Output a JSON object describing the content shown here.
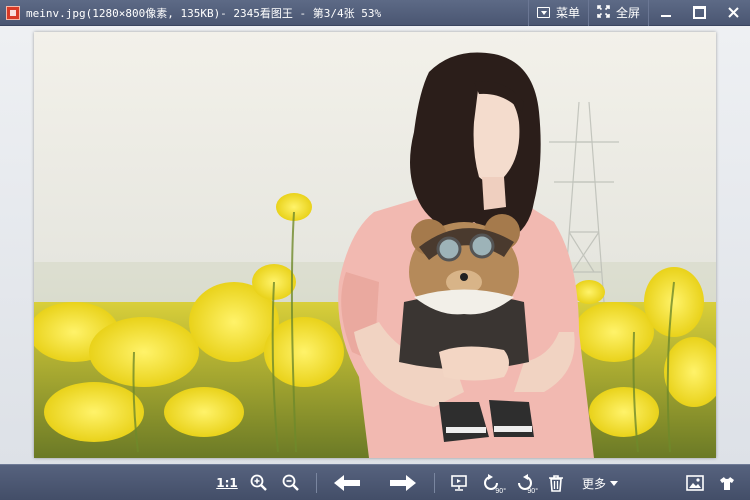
{
  "window": {
    "title": "meinv.jpg(1280×800像素, 135KB)- 2345看图王 - 第3/4张 53%",
    "menu_label": "菜单",
    "fullscreen_label": "全屏"
  },
  "toolbar": {
    "ratio_label": "1:1",
    "rotate_left_label": "90°",
    "rotate_right_label": "90°",
    "more_label": "更多"
  },
  "icons": {
    "app": "app-logo-icon",
    "menu": "dropdown-box-icon",
    "fullscreen": "expand-arrows-icon",
    "zoom_in": "zoom-in-icon",
    "zoom_out": "zoom-out-icon",
    "prev": "arrow-left-icon",
    "next": "arrow-right-icon",
    "slideshow": "presentation-screen-icon",
    "rotate_left": "rotate-left-icon",
    "rotate_right": "rotate-right-icon",
    "delete": "trash-icon",
    "wallpaper": "picture-icon",
    "skin": "tshirt-icon"
  },
  "colors": {
    "chrome": "#4a5670",
    "accent_red": "#d83a26"
  }
}
